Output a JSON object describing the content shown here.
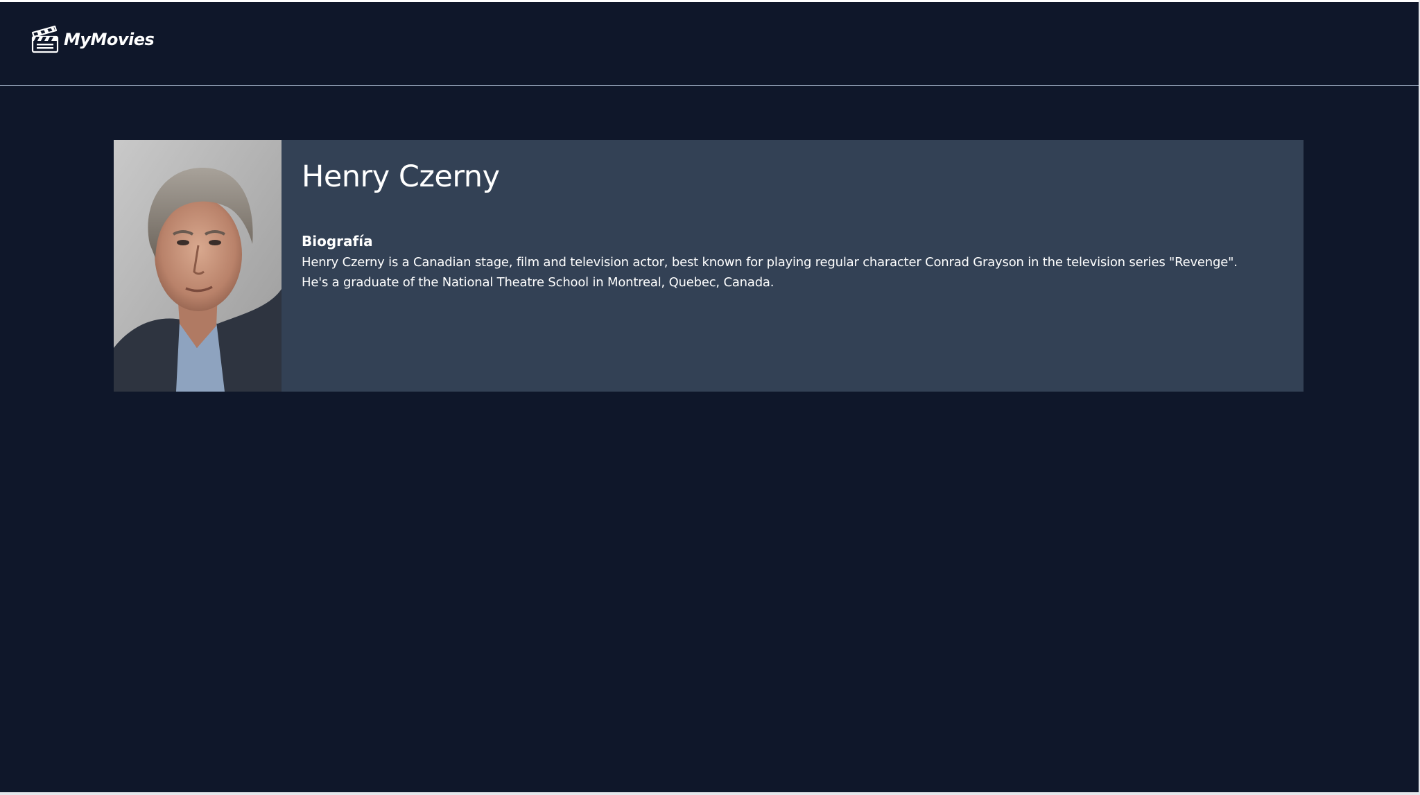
{
  "brand": {
    "name": "MyMovies",
    "icon": "clapperboard-icon"
  },
  "person": {
    "name": "Henry Czerny",
    "photo_alt": "Henry Czerny",
    "biography_heading": "Biografía",
    "biography": "Henry Czerny is a Canadian stage, film and television actor, best known for playing regular character Conrad Grayson in the television series \"Revenge\". He's a graduate of the National Theatre School in Montreal, Quebec, Canada."
  },
  "colors": {
    "background": "#0f172a",
    "card": "#334155",
    "text": "#ffffff",
    "header_border": "#94a3b8"
  }
}
